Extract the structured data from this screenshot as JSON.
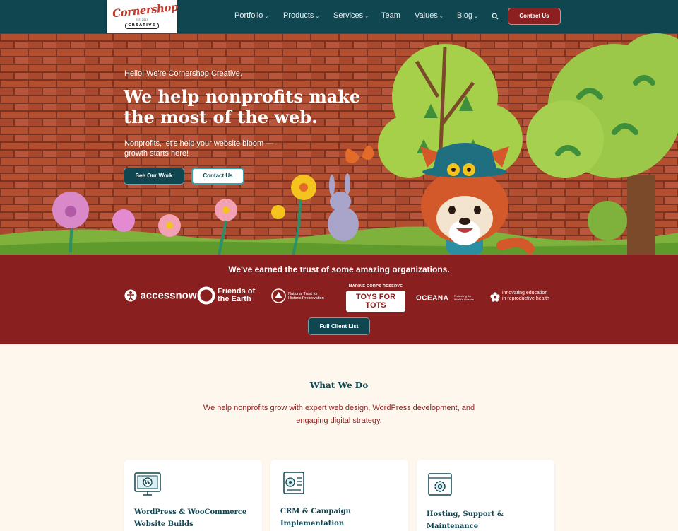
{
  "brand": {
    "logo_script": "Cornershop",
    "logo_est": "EST. 2013",
    "logo_sub": "CREATIVE"
  },
  "nav": {
    "items": [
      "Portfolio",
      "Products",
      "Services",
      "Team",
      "Values",
      "Blog"
    ],
    "contact": "Contact Us"
  },
  "hero": {
    "hello": "Hello! We're Cornershop Creative.",
    "title": "We help nonprofits make the most of the web.",
    "subtitle": "Nonprofits, let's help your website bloom — growth starts here!",
    "btn_work": "See Our Work",
    "btn_contact": "Contact Us"
  },
  "trust": {
    "title": "We've earned the trust of some amazing organizations.",
    "logos": {
      "accessnow": "accessnow",
      "foe_1": "Friends of",
      "foe_2": "the Earth",
      "nt_1": "National Trust for",
      "nt_2": "Historic Preservation",
      "tft_top": "MARINE CORPS RESERVE",
      "tft_main": "TOYS FOR TOTS",
      "oceana": "OCEANA",
      "oceana_sub": "Protecting the World's Oceans",
      "ie_1": "innovating education",
      "ie_2": "in reproductive health"
    },
    "button": "Full Client List"
  },
  "wwd": {
    "title": "What We Do",
    "description": "We help nonprofits grow with expert web design, WordPress development, and engaging digital strategy.",
    "cards": [
      {
        "label": "WordPress & WooCommerce Website Builds",
        "icon": "wordpress-monitor-icon"
      },
      {
        "label": "CRM & Campaign Implementation",
        "icon": "crm-document-icon"
      },
      {
        "label": "Hosting, Support & Maintenance",
        "icon": "hosting-gear-icon"
      }
    ]
  },
  "colors": {
    "nav": "#0f4650",
    "accent_red": "#8a1f1f",
    "cream": "#fdf7ee"
  }
}
